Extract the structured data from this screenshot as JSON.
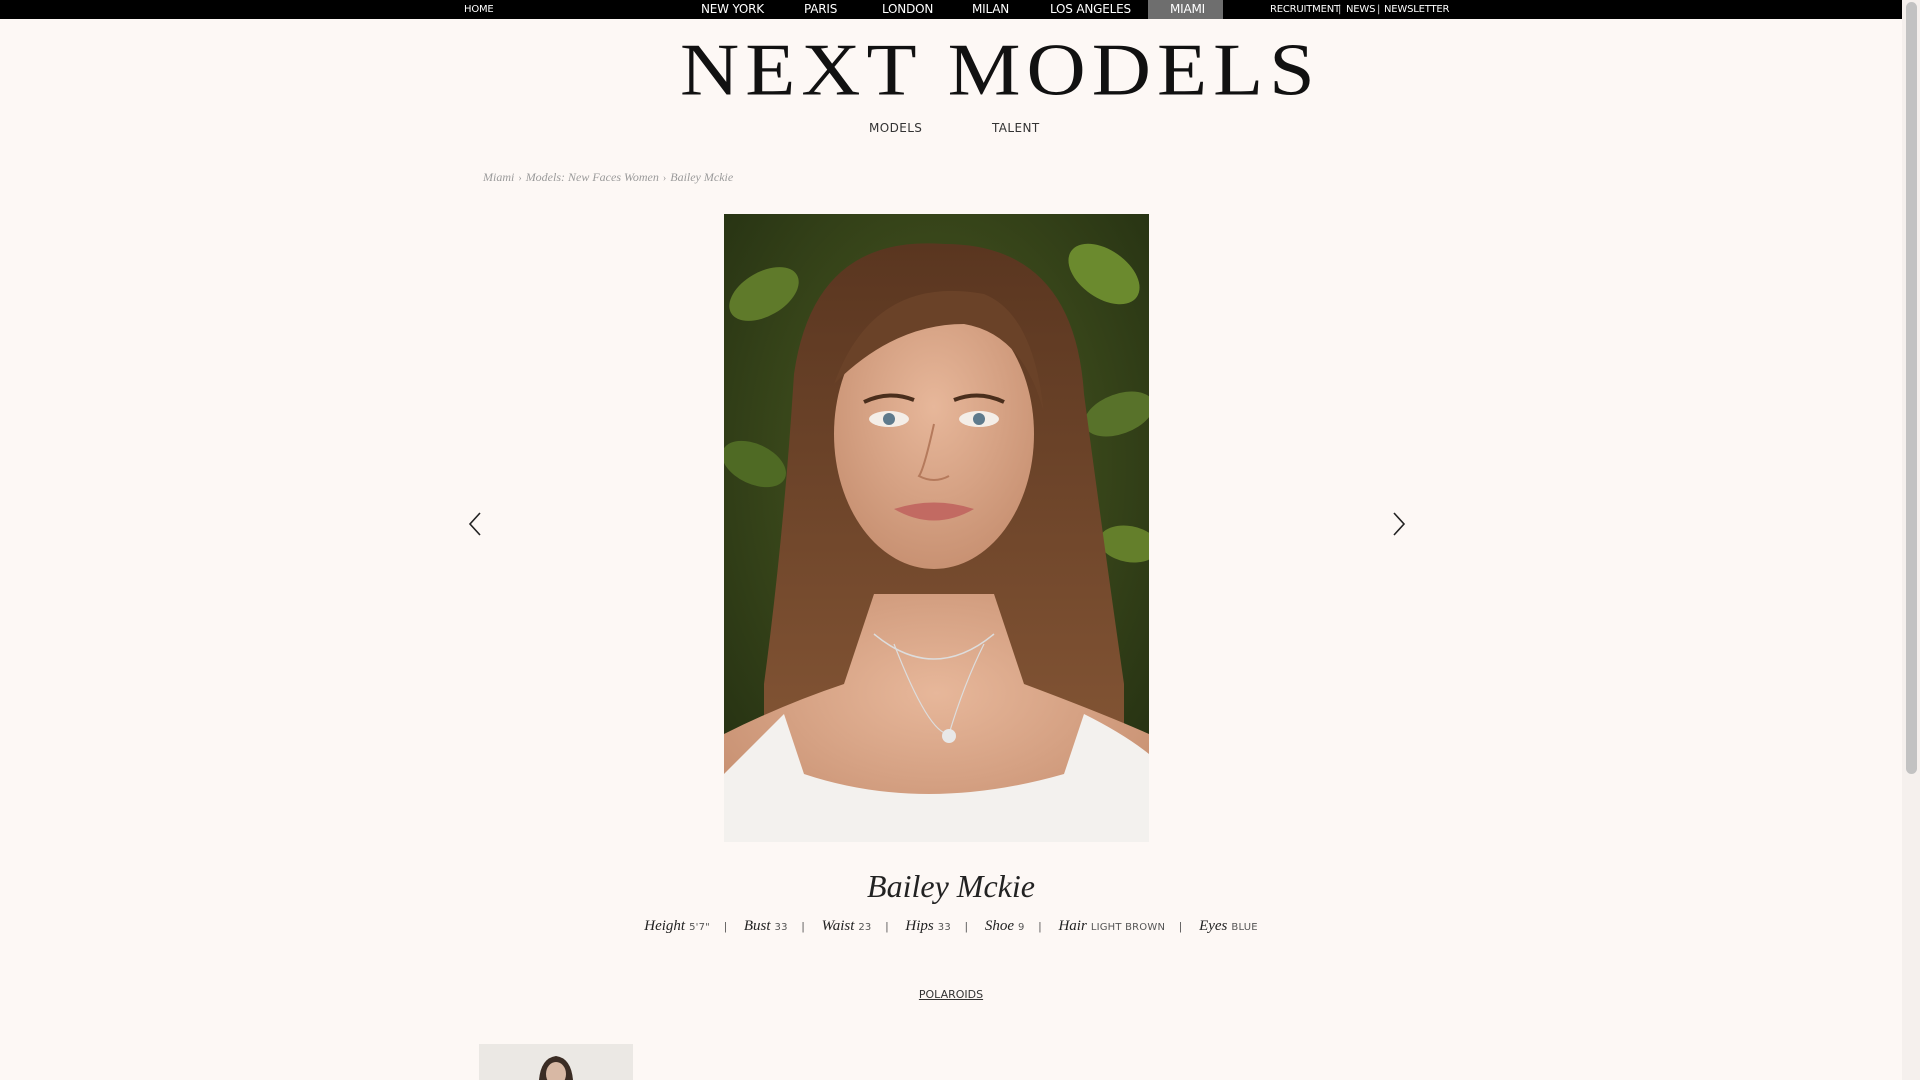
{
  "topbar": {
    "home": "HOME",
    "cities": [
      "NEW YORK",
      "PARIS",
      "LONDON",
      "MILAN",
      "LOS ANGELES",
      "MIAMI"
    ],
    "active_city": "MIAMI",
    "right_links": [
      "RECRUITMENT",
      "NEWS",
      "NEWSLETTER"
    ],
    "separator": "|"
  },
  "logo": {
    "text": "NEXT MODELS"
  },
  "subnav": {
    "models": "MODELS",
    "talent": "TALENT"
  },
  "breadcrumb": {
    "items": [
      "Miami",
      "Models: New Faces Women",
      "Bailey Mckie"
    ],
    "separator": "›"
  },
  "model": {
    "name": "Bailey Mckie",
    "stats": [
      {
        "label": "Height",
        "value": "5'7\""
      },
      {
        "label": "Bust",
        "value": "33"
      },
      {
        "label": "Waist",
        "value": "23"
      },
      {
        "label": "Hips",
        "value": "33"
      },
      {
        "label": "Shoe",
        "value": "9"
      },
      {
        "label": "Hair",
        "value": "LIGHT BROWN"
      },
      {
        "label": "Eyes",
        "value": "BLUE"
      }
    ],
    "stat_separator": "|"
  },
  "polaroids": {
    "label": "POLAROIDS"
  },
  "icons": {
    "prev": "chevron-left-icon",
    "next": "chevron-right-icon"
  },
  "colors": {
    "background": "#fdf8f5",
    "topbar": "#000000",
    "active_tab": "#6e6e6e"
  }
}
